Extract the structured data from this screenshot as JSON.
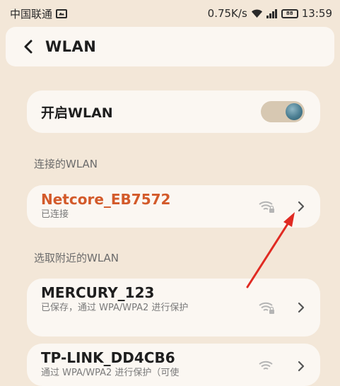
{
  "status_bar": {
    "carrier": "中国联通",
    "speed": "0.75K/s",
    "battery": "88",
    "time": "13:59"
  },
  "header": {
    "title": "WLAN"
  },
  "wlan_toggle": {
    "label": "开启WLAN",
    "enabled": true
  },
  "connected_section": {
    "label": "连接的WLAN",
    "network": {
      "name": "Netcore_EB7572",
      "status": "已连接"
    }
  },
  "nearby_section": {
    "label": "选取附近的WLAN",
    "networks": [
      {
        "name": "MERCURY_123",
        "status": "已保存，通过 WPA/WPA2 进行保护"
      },
      {
        "name": "TP-LINK_DD4CB6",
        "status": "通过 WPA/WPA2 进行保护（可使"
      }
    ]
  },
  "colors": {
    "background": "#f3e7d8",
    "card": "#fbf7f2",
    "connected_accent": "#d35a2a",
    "annotation_arrow": "#e02a22"
  }
}
